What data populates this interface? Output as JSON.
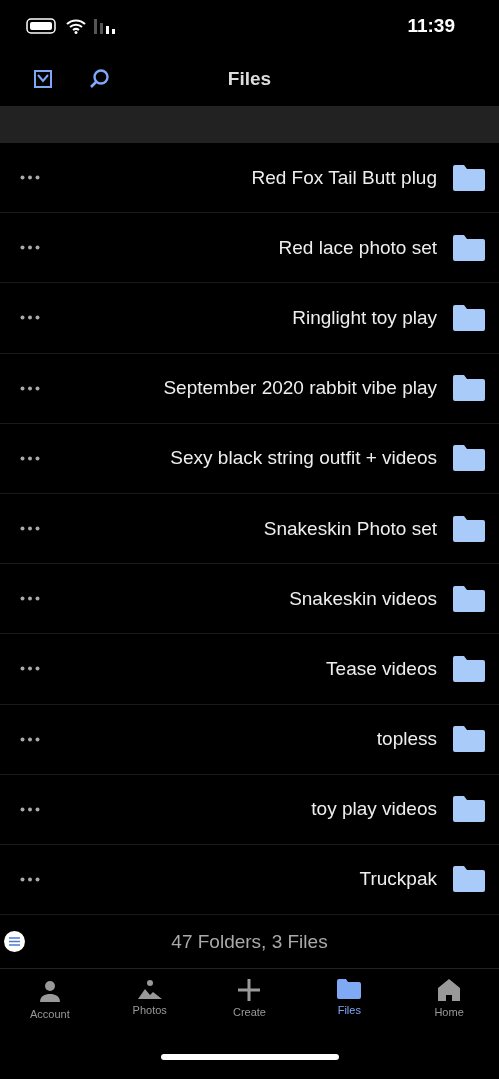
{
  "status_bar": {
    "time": "11:39"
  },
  "header": {
    "title": "Files"
  },
  "folders": [
    {
      "name": "Red Fox Tail Butt plug"
    },
    {
      "name": "Red lace photo set"
    },
    {
      "name": "Ringlight toy play"
    },
    {
      "name": "September 2020 rabbit vibe play"
    },
    {
      "name": "Sexy black string outfit + videos"
    },
    {
      "name": "Snakeskin Photo set"
    },
    {
      "name": "Snakeskin videos"
    },
    {
      "name": "Tease videos"
    },
    {
      "name": "topless"
    },
    {
      "name": "toy play videos"
    },
    {
      "name": "Truckpak"
    }
  ],
  "summary": "47 Folders, 3 Files",
  "tabs": [
    {
      "kind": "account",
      "label": "Account",
      "selected": false
    },
    {
      "kind": "photos",
      "label": "Photos",
      "selected": false
    },
    {
      "kind": "create",
      "label": "Create",
      "selected": false
    },
    {
      "kind": "files",
      "label": "Files",
      "selected": true
    },
    {
      "kind": "home",
      "label": "Home",
      "selected": false
    }
  ]
}
